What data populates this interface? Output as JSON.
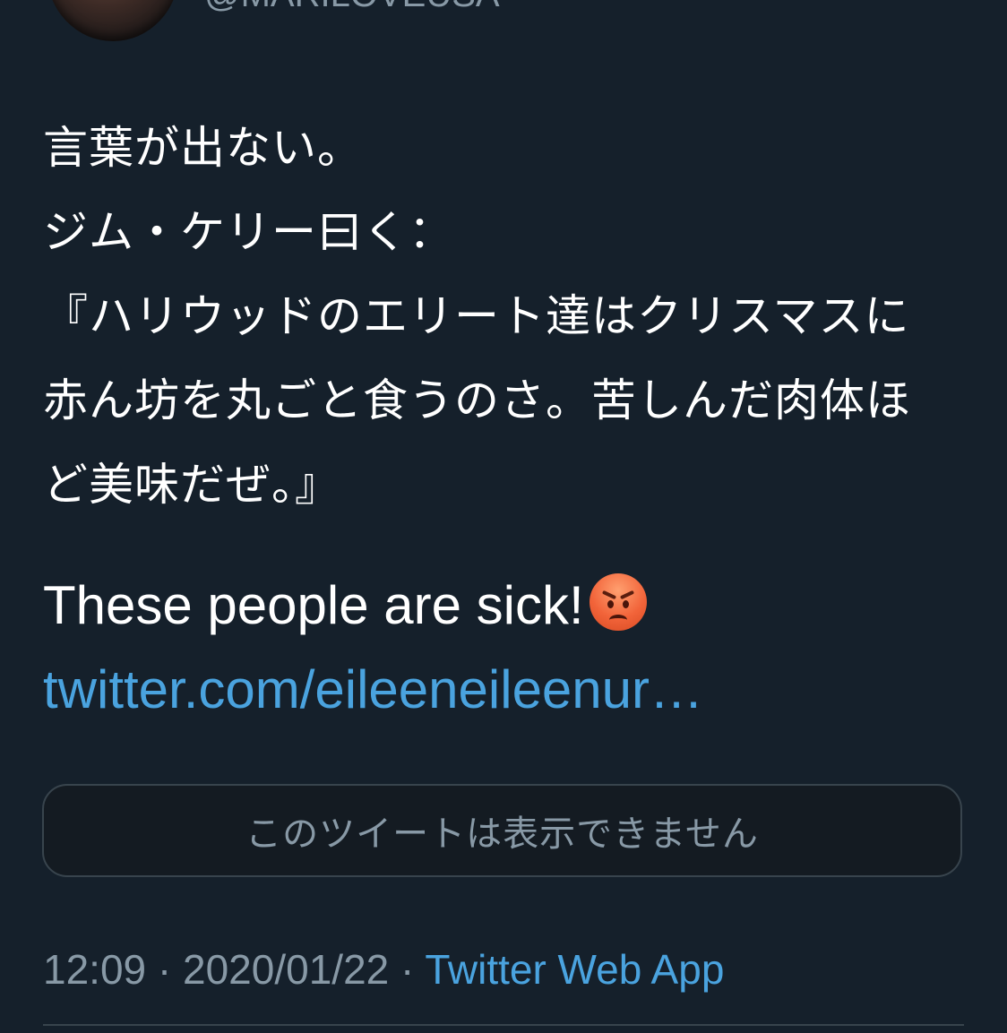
{
  "user": {
    "handle": "@MARILOVEUSA"
  },
  "tweet": {
    "line1": "言葉が出ない。",
    "line2": "ジム・ケリー曰く：\n『ハリウッドのエリート達はクリスマスに赤ん坊を丸ごと食うのさ。苦しんだ肉体ほど美味だぜ。』",
    "english": "These people are sick!",
    "emoji": "angry-face-emoji",
    "link": "twitter.com/eileeneileenur…"
  },
  "quoted_tweet": {
    "unavailable_text": "このツイートは表示できません"
  },
  "meta": {
    "time": "12:09",
    "separator": "·",
    "date": "2020/01/22",
    "source": "Twitter Web App"
  },
  "colors": {
    "background": "#15202b",
    "text": "#ffffff",
    "secondary": "#8899a6",
    "link": "#4aa3df",
    "border": "#38444d"
  }
}
